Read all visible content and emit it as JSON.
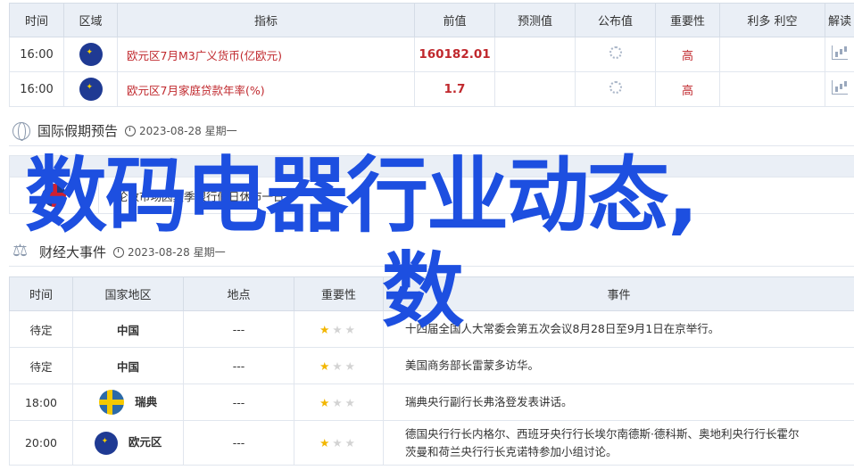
{
  "calendar": {
    "headers": [
      "时间",
      "区域",
      "指标",
      "前值",
      "预测值",
      "公布值",
      "重要性",
      "利多 利空",
      "解读"
    ],
    "rows": [
      {
        "time": "16:00",
        "region_flag": "eu-flag",
        "indicator": "欧元区7月M3广义货币(亿欧元)",
        "previous": "160182.01",
        "importance": "高"
      },
      {
        "time": "16:00",
        "region_flag": "eu-flag",
        "indicator": "欧元区7月家庭贷款年率(%)",
        "previous": "1.7",
        "importance": "高"
      }
    ]
  },
  "holiday": {
    "title": "国际假期预告",
    "date": "2023-08-28 星期一",
    "rows": [
      {
        "region_flag": "uk-flag",
        "text": "伦敦市场因夏季银行假日休市一日。"
      }
    ]
  },
  "events": {
    "title": "财经大事件",
    "date": "2023-08-28 星期一",
    "headers": [
      "时间",
      "国家地区",
      "地点",
      "重要性",
      "事件"
    ],
    "rows": [
      {
        "time": "待定",
        "country": "中国",
        "place": "---",
        "stars": 1,
        "event": "十四届全国人大常委会第五次会议8月28日至9月1日在京举行。"
      },
      {
        "time": "待定",
        "country": "中国",
        "place": "---",
        "stars": 1,
        "event": "美国商务部长雷蒙多访华。"
      },
      {
        "time": "18:00",
        "country": "瑞典",
        "flag": "se-flag",
        "place": "---",
        "stars": 1,
        "event": "瑞典央行副行长弗洛登发表讲话。"
      },
      {
        "time": "20:00",
        "country": "欧元区",
        "flag": "eu-flag",
        "place": "---",
        "stars": 1,
        "event_line1": "德国央行行长内格尔、西班牙央行行长埃尔南德斯·德科斯、奥地利央行行长霍尔",
        "event_line2": "茨曼和荷兰央行行长克诺特参加小组讨论。"
      }
    ]
  },
  "overlay": {
    "line1": "数码电器行业动态,",
    "line2": "数"
  }
}
